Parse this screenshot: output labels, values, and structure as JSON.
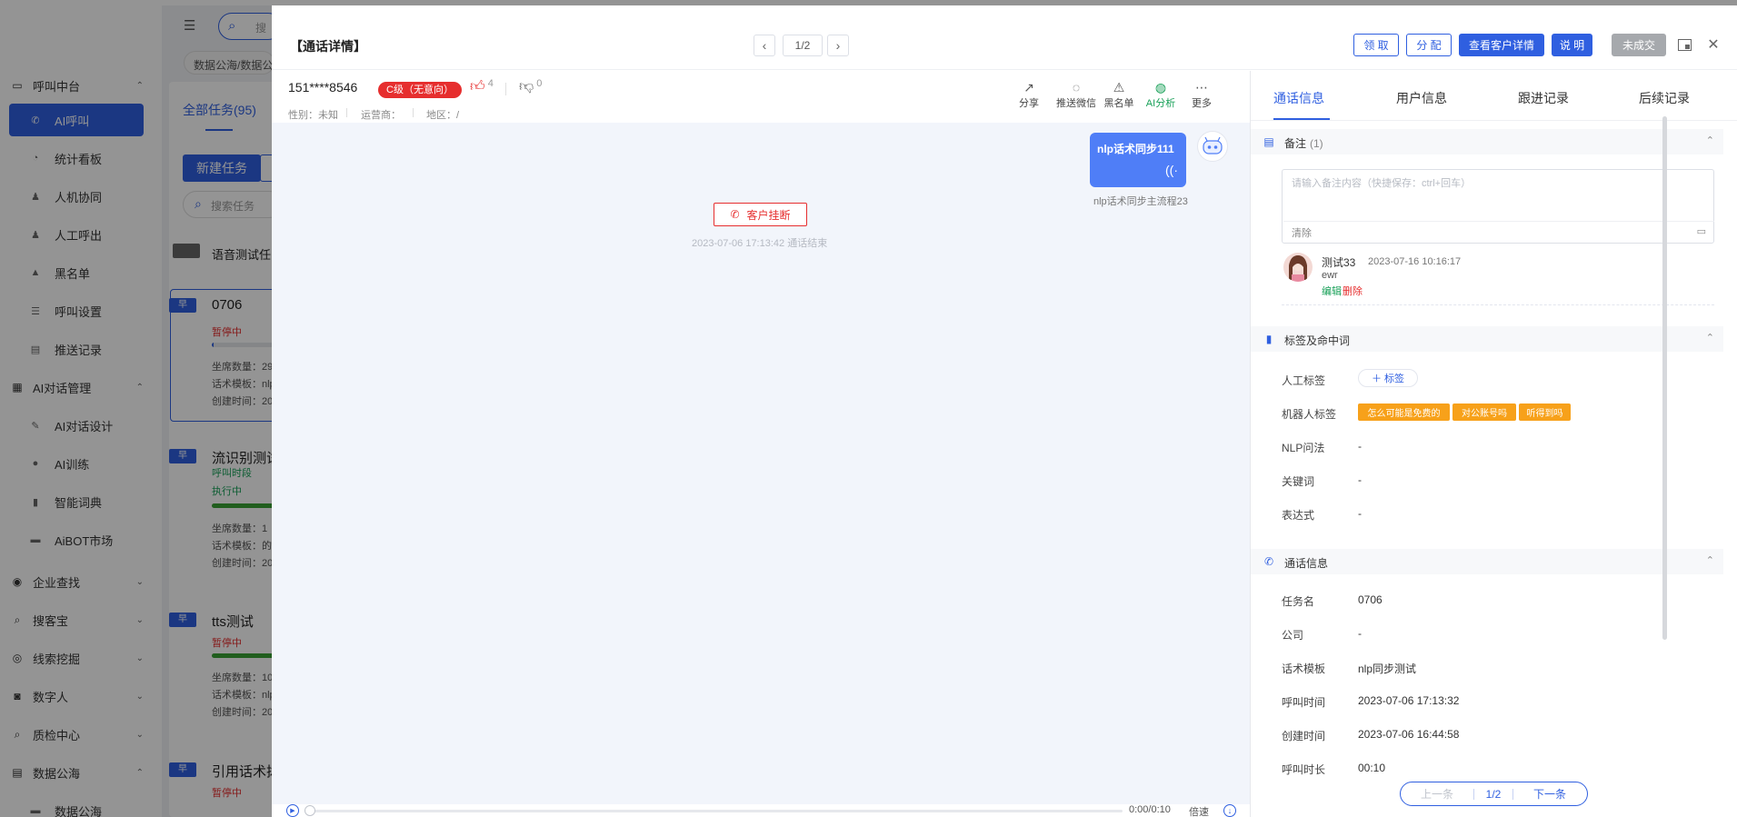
{
  "background": {
    "sidebar": {
      "groups": [
        {
          "label": "呼叫中台",
          "icon": "monitor-icon",
          "chev": "⌃"
        },
        {
          "label": "AI对话管理",
          "icon": "table-icon",
          "chev": "⌃"
        },
        {
          "label": "企业查找",
          "icon": "bulb-icon",
          "chev": "⌄"
        },
        {
          "label": "搜客宝",
          "icon": "search-icon",
          "chev": "⌄"
        },
        {
          "label": "线索挖掘",
          "icon": "dig-icon",
          "chev": "⌄"
        },
        {
          "label": "数字人",
          "icon": "robot-icon",
          "chev": "⌄"
        },
        {
          "label": "质检中心",
          "icon": "inspect-icon",
          "chev": "⌄"
        },
        {
          "label": "数据公海",
          "icon": "database-icon",
          "chev": "⌃"
        }
      ],
      "items": [
        {
          "label": "AI呼叫",
          "icon": "phone-icon"
        },
        {
          "label": "统计看板",
          "icon": "pie-icon"
        },
        {
          "label": "人机协同",
          "icon": "users-icon"
        },
        {
          "label": "人工呼出",
          "icon": "user-call-icon"
        },
        {
          "label": "黑名单",
          "icon": "warning-icon"
        },
        {
          "label": "呼叫设置",
          "icon": "sliders-icon"
        },
        {
          "label": "推送记录",
          "icon": "doc-icon"
        },
        {
          "label": "AI对话设计",
          "icon": "pen-icon"
        },
        {
          "label": "AI训练",
          "icon": "chat-icon"
        },
        {
          "label": "智能词典",
          "icon": "book-icon"
        },
        {
          "label": "AiBOT市场",
          "icon": "store-icon"
        },
        {
          "label": "数据公海",
          "icon": "db-item-icon"
        }
      ]
    },
    "main": {
      "menu_icon": "☰",
      "search_partial": "搜",
      "breadcrumb": "数据公海/数据公",
      "tab_all": "全部任务(95)",
      "new_task_label": "新建任务",
      "search_task_placeholder": "搜索任务",
      "group_label": "语音测试任",
      "tasks": [
        {
          "tag": "早",
          "title": "0706",
          "status": "暂停中",
          "status_color": "#e62e2e",
          "progress": 0.02,
          "meta": [
            "坐席数量：29",
            "话术模板：nlp",
            "创建时间：20"
          ]
        },
        {
          "tag": "早",
          "title": "流识别测试",
          "sub": "呼叫时段",
          "status": "执行中",
          "status_color": "#18a058",
          "progress": 0.85,
          "meta": [
            "坐席数量：1（",
            "话术模板：的",
            "创建时间：20"
          ]
        },
        {
          "tag": "早",
          "title": "tts测试",
          "status": "暂停中",
          "status_color": "#e62e2e",
          "progress": 0.85,
          "meta": [
            "坐席数量：10",
            "话术模板：nlp",
            "创建时间：20"
          ]
        },
        {
          "tag": "早",
          "title": "引用话术拨",
          "status": "暂停中",
          "status_color": "#e62e2e",
          "progress": 0.0,
          "meta": []
        }
      ]
    }
  },
  "drawer": {
    "title": "【通话详情】",
    "pager": {
      "prev": "‹",
      "count": "1/2",
      "next": "›"
    },
    "buttons": {
      "claim": "领 取",
      "assign": "分 配",
      "view_customer": "查看客户详情",
      "explain": "说 明",
      "deal_status": "未成交"
    },
    "icons": {
      "restore": "restore-window-icon",
      "close": "close-icon"
    },
    "customer": {
      "phone": "151****8546",
      "level": "C级（无意向）",
      "likes": "4",
      "dislikes": "0",
      "gender": "性别：未知",
      "carrier": "运营商：",
      "region": "地区：/"
    },
    "tools": [
      {
        "label": "分享",
        "icon": "share-icon",
        "glyph": "↗"
      },
      {
        "label": "推送微信",
        "icon": "wechat-icon",
        "glyph": "💬"
      },
      {
        "label": "黑名单",
        "icon": "warning-icon",
        "glyph": "⚠"
      },
      {
        "label": "AI分析",
        "icon": "ai-analysis-icon",
        "glyph": "◍"
      },
      {
        "label": "更多",
        "icon": "more-icon",
        "glyph": "⋯"
      }
    ],
    "chat": {
      "bubble_text": "nlp话术同步111",
      "bubble_caption": "nlp话术同步主流程23",
      "hangup_label": "客户挂断",
      "hangup_time": "2023-07-06 17:13:42 通话结束"
    },
    "player": {
      "time": "0:00/0:10",
      "speed": "倍速",
      "progress": 0.0
    },
    "right": {
      "tabs": [
        "通话信息",
        "用户信息",
        "跟进记录",
        "后续记录"
      ],
      "remark": {
        "title": "备注",
        "count": "(1)",
        "placeholder": "请输入备注内容（快捷保存：ctrl+回车）",
        "clear": "清除",
        "note_user": "测试33",
        "note_time": "2023-07-16 10:16:17",
        "note_content": "ewr",
        "edit": "编辑",
        "delete": "删除"
      },
      "tags": {
        "title": "标签及命中词",
        "manual_label": "人工标签",
        "add_tag": "＋ 标签",
        "robot_label": "机器人标签",
        "robot_tags": [
          "怎么可能是免费的",
          "对公账号吗",
          "听得到吗"
        ],
        "nlp_label": "NLP问法",
        "nlp_value": "-",
        "keyword_label": "关键词",
        "keyword_value": "-",
        "expr_label": "表达式",
        "expr_value": "-"
      },
      "call_info": {
        "title": "通话信息",
        "rows": [
          {
            "label": "任务名",
            "value": "0706"
          },
          {
            "label": "公司",
            "value": "-"
          },
          {
            "label": "话术模板",
            "value": "nlp同步测试"
          },
          {
            "label": "呼叫时间",
            "value": "2023-07-06 17:13:32"
          },
          {
            "label": "创建时间",
            "value": "2023-07-06 16:44:58"
          },
          {
            "label": "呼叫时长",
            "value": "00:10"
          }
        ]
      },
      "bottom_pager": {
        "prev": "上一条",
        "count": "1/2",
        "next": "下一条"
      }
    }
  }
}
